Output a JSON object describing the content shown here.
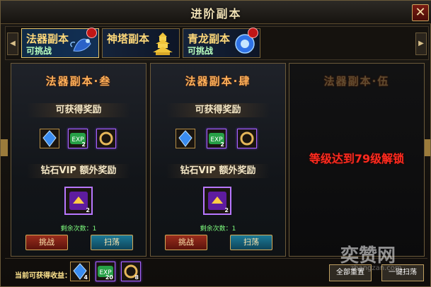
{
  "window": {
    "title": "进阶副本",
    "close_icon": "close-icon"
  },
  "tabs": [
    {
      "name": "法器副本",
      "status": "可挑战",
      "badge": "e",
      "art_icon": "beast-icon"
    },
    {
      "name": "神塔副本",
      "status": "",
      "badge": "",
      "art_icon": "pagoda-icon"
    },
    {
      "name": "青龙副本",
      "status": "可挑战",
      "badge": "e",
      "art_icon": "orb-icon"
    }
  ],
  "panels": [
    {
      "title": "法器副本·叁",
      "reward_label": "可获得奖励",
      "vip_label": "钻石VIP  额外奖励",
      "remain_text": "剩余次数：1",
      "challenge_label": "挑战",
      "sweep_label": "扫荡",
      "rewards": [
        {
          "icon": "crystal-icon",
          "count": ""
        },
        {
          "icon": "exp-icon",
          "count": "2"
        },
        {
          "icon": "ring-icon",
          "count": ""
        }
      ],
      "vip_reward": {
        "icon": "purple-card-icon",
        "count": "2"
      }
    },
    {
      "title": "法器副本·肆",
      "reward_label": "可获得奖励",
      "vip_label": "钻石VIP  额外奖励",
      "remain_text": "剩余次数：1",
      "challenge_label": "挑战",
      "sweep_label": "扫荡",
      "rewards": [
        {
          "icon": "crystal-icon",
          "count": ""
        },
        {
          "icon": "exp-icon",
          "count": "2"
        },
        {
          "icon": "ring-icon",
          "count": ""
        }
      ],
      "vip_reward": {
        "icon": "purple-card-icon",
        "count": "2"
      }
    },
    {
      "title": "法器副本·伍",
      "lock_text": "等级达到79级解锁"
    }
  ],
  "bottom": {
    "gain_label": "当前可获得收益：",
    "gains": [
      {
        "icon": "crystal-icon",
        "count": "4"
      },
      {
        "icon": "exp-icon",
        "count": "20"
      },
      {
        "icon": "ring-icon",
        "count": "8"
      }
    ],
    "btn_left": "全部重置",
    "btn_right": "一键扫荡"
  },
  "watermark": {
    "text": "奕赞网",
    "url": "zhangzan.com"
  }
}
